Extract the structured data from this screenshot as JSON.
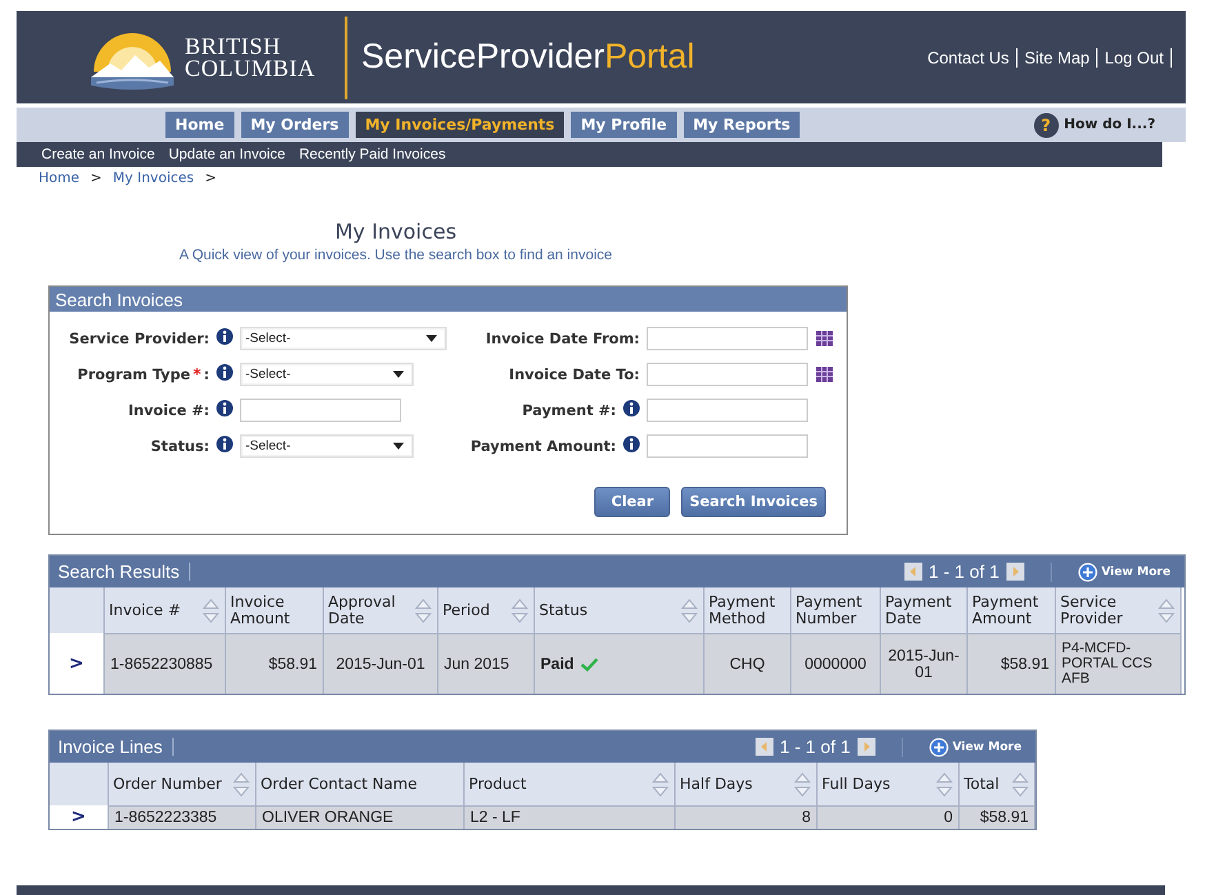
{
  "header": {
    "logo_lines": [
      "BRITISH",
      "COLUMBIA"
    ],
    "portal_main": "ServiceProvider",
    "portal_accent": "Portal",
    "links": [
      "Contact Us",
      "Site Map",
      "Log Out"
    ]
  },
  "nav": {
    "tabs": [
      {
        "label": "Home",
        "selected": false
      },
      {
        "label": "My Orders",
        "selected": false
      },
      {
        "label": "My Invoices/Payments",
        "selected": true
      },
      {
        "label": "My Profile",
        "selected": false
      },
      {
        "label": "My Reports",
        "selected": false
      }
    ],
    "help_icon": "?",
    "help_label": "How do I...?"
  },
  "subnav": [
    "Create an Invoice",
    "Update an Invoice",
    "Recently Paid Invoices"
  ],
  "breadcrumb": [
    {
      "label": "Home",
      "kind": "link"
    },
    {
      "label": ">",
      "kind": "sep"
    },
    {
      "label": "My Invoices",
      "kind": "link"
    },
    {
      "label": ">",
      "kind": "sep"
    }
  ],
  "page": {
    "title": "My Invoices",
    "subtitle": "A Quick view of your invoices. Use the search box to find an invoice"
  },
  "search": {
    "title": "Search Invoices",
    "required_mark": "*",
    "rows": [
      {
        "left": {
          "label": "Service Provider:",
          "required": false,
          "info": true,
          "kind": "select",
          "value": "-Select-",
          "wide": true
        },
        "right": {
          "label": "Invoice Date From:",
          "required": false,
          "kind": "date",
          "info": false
        }
      },
      {
        "left": {
          "label": "Program Type",
          "label_end": ":",
          "required": true,
          "info": true,
          "kind": "select",
          "value": "-Select-",
          "wide": false
        },
        "right": {
          "label": "Invoice Date To:",
          "required": false,
          "kind": "date",
          "info": false
        }
      },
      {
        "left": {
          "label": "Invoice #:",
          "required": false,
          "info": true,
          "kind": "text",
          "wide": false
        },
        "right": {
          "label": "Payment #:",
          "required": false,
          "kind": "text",
          "info": true
        }
      },
      {
        "left": {
          "label": "Status:",
          "required": false,
          "info": true,
          "kind": "select",
          "value": "-Select-",
          "wide": false
        },
        "right": {
          "label": "Payment Amount:",
          "required": false,
          "kind": "text",
          "info": true
        }
      }
    ],
    "buttons": [
      "Clear",
      "Search Invoices"
    ]
  },
  "results": {
    "title": "Search Results",
    "pager": "1 - 1 of 1",
    "view_more": "View More",
    "columns": [
      {
        "sortable": false
      },
      {
        "label": "Invoice #",
        "sortable": true
      },
      {
        "label": "Invoice Amount",
        "sortable": false
      },
      {
        "label": "Approval Date",
        "sortable": true
      },
      {
        "label": "Period",
        "sortable": true
      },
      {
        "label": "Status",
        "sortable": true
      },
      {
        "label": "Payment Method",
        "sortable": false
      },
      {
        "label": "Payment Number",
        "sortable": false
      },
      {
        "label": "Payment Date",
        "sortable": false
      },
      {
        "label": "Payment Amount",
        "sortable": false
      },
      {
        "label": "Service Provider",
        "sortable": true
      }
    ],
    "rows": [
      {
        "cells": [
          ">",
          "1-8652230885",
          "$58.91",
          "2015-Jun-01",
          "Jun 2015",
          "Paid",
          "CHQ",
          "0000000",
          "2015-Jun-01",
          "$58.91",
          "P4-MCFD-PORTAL CCS AFB"
        ],
        "status_ok": true
      }
    ]
  },
  "lines": {
    "title": "Invoice Lines",
    "pager": "1 - 1 of 1",
    "view_more": "View More",
    "columns": [
      {
        "sortable": false
      },
      {
        "label": "Order Number",
        "sortable": true
      },
      {
        "label": "Order Contact Name",
        "sortable": false
      },
      {
        "label": "Product",
        "sortable": true
      },
      {
        "label": "Half Days",
        "sortable": true
      },
      {
        "label": "Full Days",
        "sortable": true
      },
      {
        "label": "Total",
        "sortable": true
      }
    ],
    "rows": [
      {
        "cells": [
          ">",
          "1-8652223385",
          "OLIVER ORANGE",
          "L2 - LF",
          "8",
          "0",
          "$58.91"
        ]
      }
    ]
  }
}
